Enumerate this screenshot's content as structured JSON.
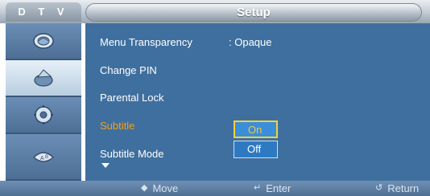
{
  "header": {
    "source_label": "D T V",
    "title": "Setup"
  },
  "sidebar": {
    "items": [
      {
        "icon": "picture-icon",
        "selected": false
      },
      {
        "icon": "sound-icon",
        "selected": true
      },
      {
        "icon": "setup-gear-icon",
        "selected": false
      },
      {
        "icon": "input-icon",
        "selected": false
      }
    ]
  },
  "menu": {
    "items": [
      {
        "label": "Menu Transparency",
        "value": ": Opaque"
      },
      {
        "label": "Change PIN",
        "value": ""
      },
      {
        "label": "Parental Lock",
        "value": ""
      },
      {
        "label": "Subtitle",
        "value": ""
      },
      {
        "label": "Subtitle Mode",
        "value": ""
      }
    ],
    "highlighted_item": "Subtitle"
  },
  "dropdown": {
    "options": [
      "On",
      "Off"
    ],
    "selected": "On"
  },
  "footer": {
    "move_label": "Move",
    "enter_label": "Enter",
    "return_label": "Return"
  },
  "colors": {
    "panel": "#3f6f9e",
    "highlight_text": "#f0a11f",
    "selection_border": "#f5d23a"
  }
}
